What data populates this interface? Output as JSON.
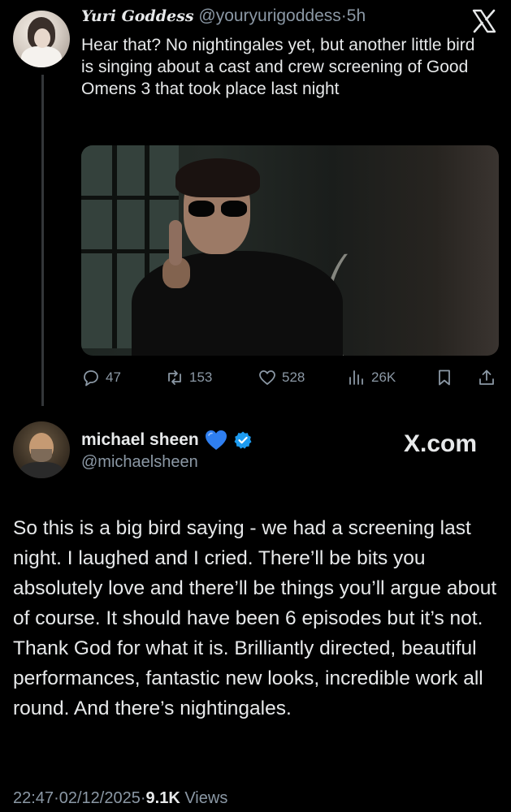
{
  "tweet1": {
    "display_name": "Yuri Goddess",
    "handle": "@youryurigoddess",
    "dot": "·",
    "time": "5h",
    "text": "Hear that? No nightingales yet, but another little bird is singing about a cast and crew screening of Good Omens 3 that took place last night",
    "actions": {
      "replies": "47",
      "reposts": "153",
      "likes": "528",
      "views": "26K"
    }
  },
  "tweet2": {
    "display_name": "michael sheen",
    "heart_emoji": "💙",
    "handle": "@michaelsheen",
    "text": "So this is a big bird saying - we had a screening last night. I laughed and I cried. There’ll be bits you absolutely love and there’ll be things you’ll argue about of course. It should have been 6 episodes but it’s not. Thank God for what it is. Brilliantly directed, beautiful performances, fantastic new looks, incredible work all round. And there’s nightingales.",
    "time": "22:47",
    "date": "02/12/2025",
    "views_count": "9.1K",
    "views_label": "Views",
    "separator": "·"
  },
  "watermark": "X.com",
  "colors": {
    "background": "#000000",
    "text_primary": "#e7e9ea",
    "text_secondary": "#8b98a5",
    "verified_blue": "#1d9bf0",
    "heart_blue": "#2f7ff0"
  },
  "icons": [
    "x-logo-icon",
    "reply-icon",
    "repost-icon",
    "like-icon",
    "views-icon",
    "bookmark-icon",
    "share-icon",
    "verified-badge-icon",
    "blue-heart-icon"
  ]
}
